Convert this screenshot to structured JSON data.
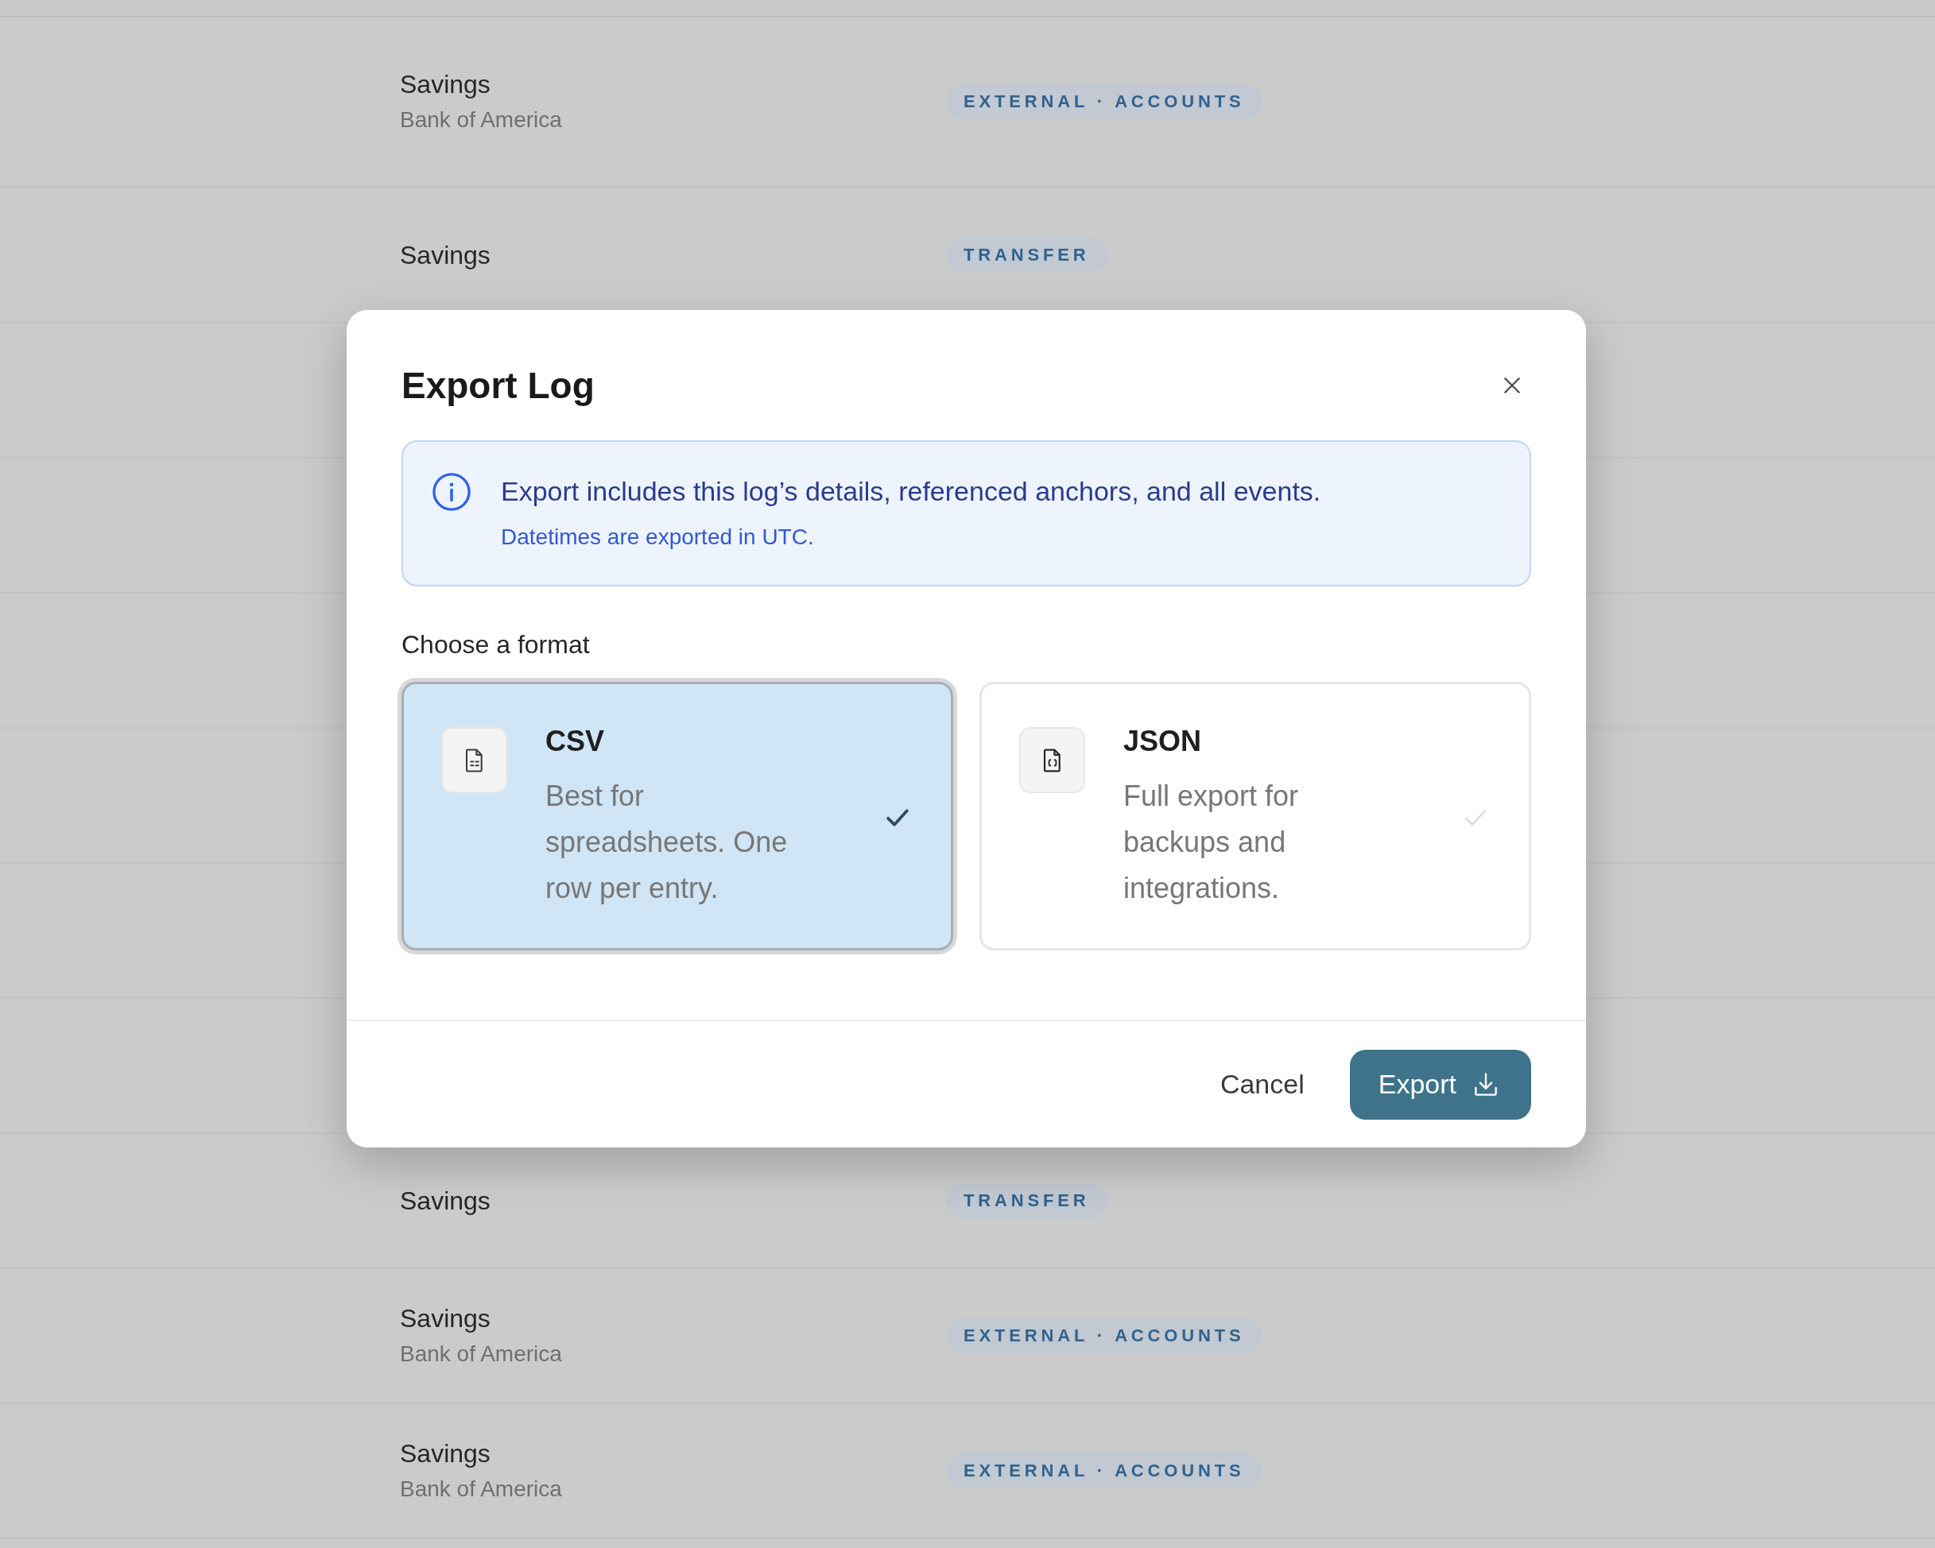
{
  "background_table": {
    "rows_top": [
      {
        "name": "Savings",
        "institution": "Bank of America",
        "tag": "EXTERNAL · ACCOUNTS"
      },
      {
        "name": "Savings",
        "tag": "TRANSFER"
      }
    ],
    "rows_bottom": [
      {
        "name": "Savings",
        "tag": "TRANSFER"
      },
      {
        "name": "Savings",
        "institution": "Bank of America",
        "tag": "EXTERNAL · ACCOUNTS"
      },
      {
        "name": "Savings",
        "institution": "Bank of America",
        "tag": "EXTERNAL · ACCOUNTS"
      }
    ]
  },
  "dialog": {
    "title": "Export Log",
    "notice": {
      "message": "Export includes this log’s details, referenced anchors, and all events.",
      "note": "Datetimes are exported in UTC."
    },
    "format_heading": "Choose a format",
    "formats": [
      {
        "kind": "csv",
        "label": "CSV",
        "description": "Best for spreadsheets. One row per entry.",
        "selected": true
      },
      {
        "kind": "json",
        "label": "JSON",
        "description": "Full export for backups and integrations.",
        "selected": false
      }
    ],
    "buttons": [
      {
        "kind": "secondary",
        "label": "Cancel"
      },
      {
        "kind": "primary",
        "label": "Export"
      }
    ]
  }
}
